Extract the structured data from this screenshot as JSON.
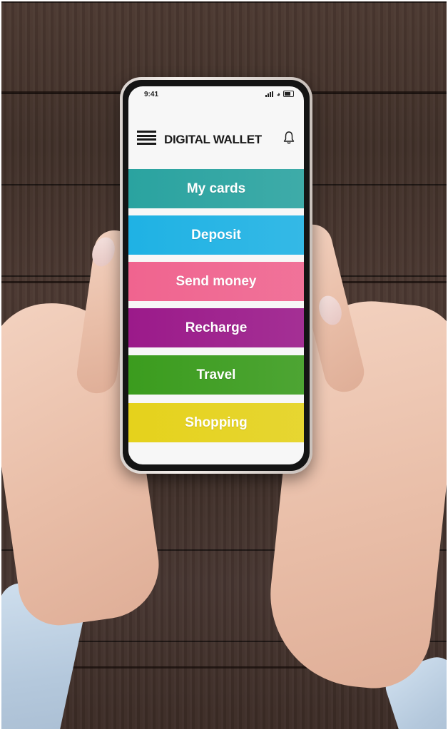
{
  "status_bar": {
    "time": "9:41"
  },
  "header": {
    "title": "DIGITAL WALLET",
    "menu_icon": "hamburger-menu-icon",
    "notification_icon": "bell-icon"
  },
  "menu_items": [
    {
      "label": "My cards",
      "color": "#2aa3a0"
    },
    {
      "label": "Deposit",
      "color": "#1fb2e4"
    },
    {
      "label": "Send money",
      "color": "#f0648f"
    },
    {
      "label": "Recharge",
      "color": "#9b1a8a"
    },
    {
      "label": "Travel",
      "color": "#3b9c1e"
    },
    {
      "label": "Shopping",
      "color": "#e5d21c"
    }
  ]
}
